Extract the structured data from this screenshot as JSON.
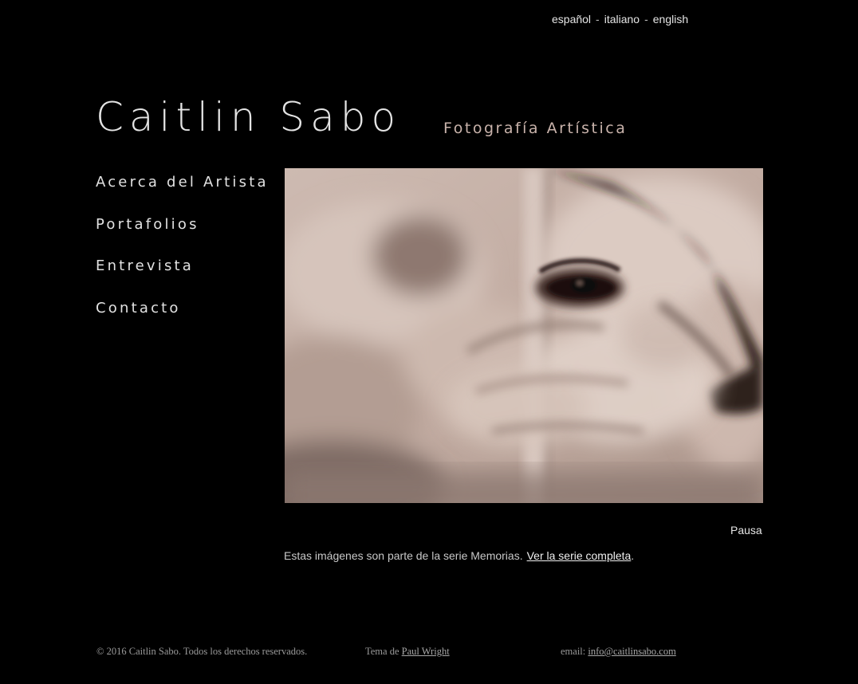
{
  "languages": [
    {
      "label": "español"
    },
    {
      "label": "italiano"
    },
    {
      "label": "english"
    }
  ],
  "language_separator": "-",
  "header": {
    "title": "Caitlin Sabo",
    "tagline": "Fotografía Artística"
  },
  "nav": {
    "items": [
      {
        "label": "Acerca del Artista"
      },
      {
        "label": "Portafolios"
      },
      {
        "label": "Entrevista"
      },
      {
        "label": "Contacto"
      }
    ]
  },
  "slideshow": {
    "pause_label": "Pausa",
    "series_text": "Estas imágenes son parte de la serie Memorias.",
    "series_link": "Ver la serie completa",
    "series_end": "."
  },
  "footer": {
    "copyright": "© 2016 Caitlin Sabo. Todos los derechos reservados.",
    "theme_prefix": "Tema de",
    "theme_author": "Paul Wright",
    "email_prefix": "email:",
    "email_address": "info@caitlinsabo.com"
  },
  "colors": {
    "background": "#000000",
    "text": "#e2e2e2",
    "tagline": "#c9b3ab",
    "photo_tone": "#c6b3aa"
  }
}
